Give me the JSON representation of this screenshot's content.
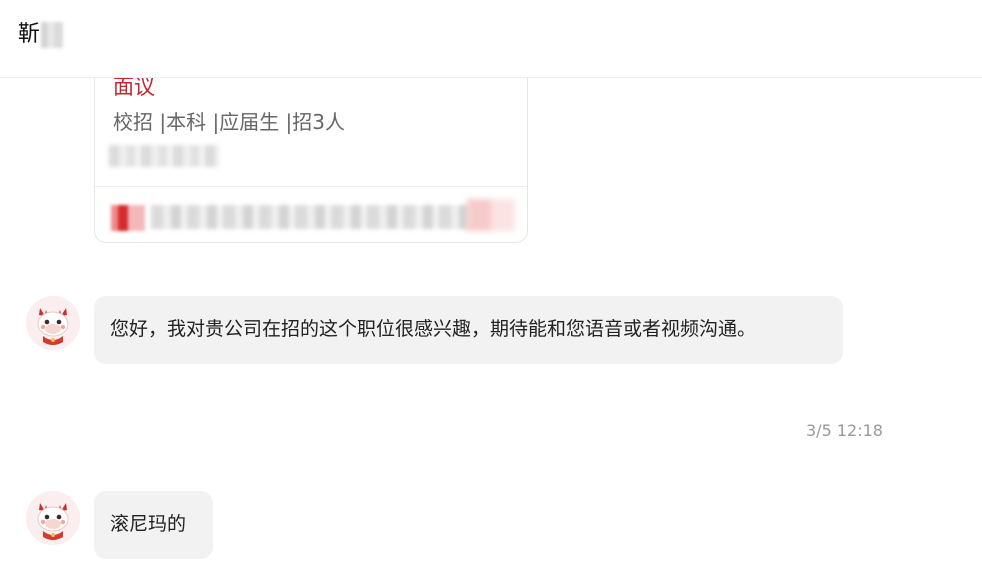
{
  "header": {
    "title": "靳"
  },
  "job_card": {
    "title": "面议",
    "tags": "校招 |本科 |应届生 |招3人"
  },
  "messages": [
    {
      "text": "您好，我对贵公司在招的这个职位很感兴趣，期待能和您语音或者视频沟通。",
      "avatar": "dragon-avatar-icon"
    },
    {
      "text": "滚尼玛的",
      "avatar": "dragon-avatar-icon"
    }
  ],
  "timestamp": "3/5 12:18",
  "colors": {
    "accent_red": "#c7242d",
    "bubble_bg": "#f2f2f2",
    "timestamp_gray": "#999999"
  }
}
